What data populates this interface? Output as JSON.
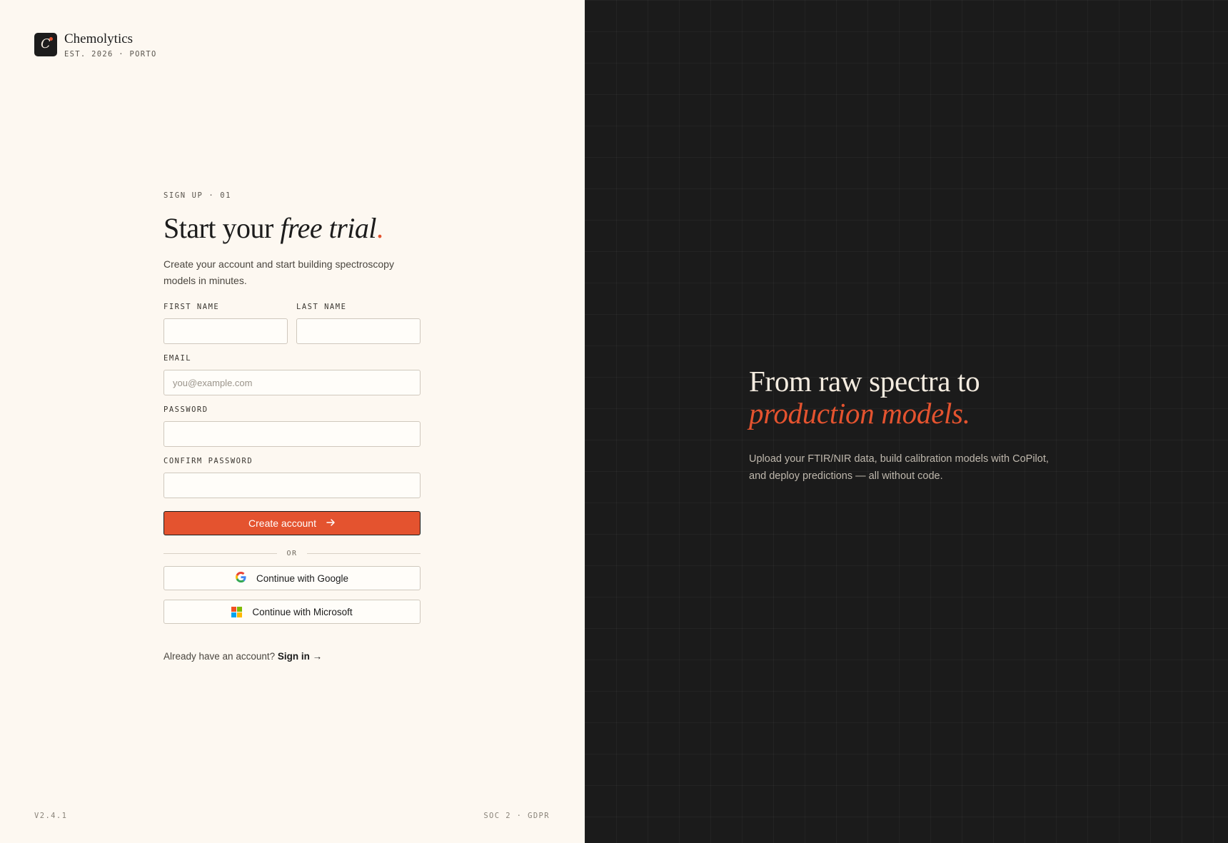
{
  "brand": {
    "logo_letter": "C",
    "name": "Chemolytics",
    "tagline": "EST. 2026 · PORTO"
  },
  "form": {
    "eyebrow": "SIGN UP · 01",
    "heading_start": "Start your ",
    "heading_emphasis": "free trial",
    "heading_end": ".",
    "lead": "Create your account and start building spectroscopy models in minutes.",
    "first_name_label": "FIRST NAME",
    "first_name_value": "",
    "last_name_label": "LAST NAME",
    "last_name_value": "",
    "email_label": "EMAIL",
    "email_placeholder": "you@example.com",
    "password_label": "PASSWORD",
    "confirm_password_label": "CONFIRM PASSWORD",
    "submit_label": "Create account",
    "submit_icon": "arrow-right-icon",
    "divider_label": "OR",
    "google_label": "Continue with Google",
    "microsoft_label": "Continue with Microsoft",
    "signin_prompt": "Already have an account?",
    "signin_link": "Sign in →"
  },
  "footer": {
    "version": "V2.4.1",
    "compliance": "SOC 2 · GDPR"
  },
  "hero": {
    "line1": "From raw spectra to",
    "line2": "production models.",
    "body": "Upload your FTIR/NIR data, build calibration models with CoPilot, and deploy predictions — all without code."
  },
  "colors": {
    "accent": "#e4532f",
    "page_bg": "#fdf8f1",
    "panel_bg": "#1b1b1b",
    "ink": "#1c1c1c"
  }
}
